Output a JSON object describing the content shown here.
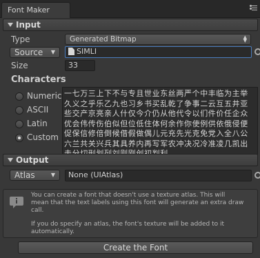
{
  "window": {
    "tab_title": "Font Maker"
  },
  "input_section": {
    "header": "Input",
    "type_label": "Type",
    "type_value": "Generated Bitmap",
    "source_popup": "Source",
    "source_value": "SIMLI",
    "size_label": "Size",
    "size_value": "33"
  },
  "characters": {
    "header": "Characters",
    "options": [
      {
        "label": "Numeric",
        "checked": false
      },
      {
        "label": "ASCII",
        "checked": false
      },
      {
        "label": "Latin",
        "checked": false
      },
      {
        "label": "Custom",
        "checked": true
      }
    ],
    "text": "一七万三上下不与专且世业东丝两严个中丰临为主举久义之乎乐乙九也习乡书买乱乾了争事二云互五井亚些交产京亮亲人什仅今介仍从他代令以们件价任企众优会伟传伤伯似但位低住体何余作你使例供依俄侵便促保信修倍倒候借假做偶儿元充先光克免党入全八公六兰共关兴兵其具养内再写军农冲决况冷准凌几凯出击分切刑划列刘则刚创初判利"
  },
  "output_section": {
    "header": "Output",
    "atlas_popup": "Atlas",
    "atlas_value": "None (UIAtlas)"
  },
  "help": {
    "icon": "info-icon",
    "paragraph1": "You can create a font that doesn't use a texture atlas. This will\nmean that the text labels using this font will generate an extra draw\ncall.",
    "paragraph2": "If you do specify an atlas, the font's texture will be added to it\nautomatically."
  },
  "actions": {
    "create_button": "Create the Font"
  }
}
